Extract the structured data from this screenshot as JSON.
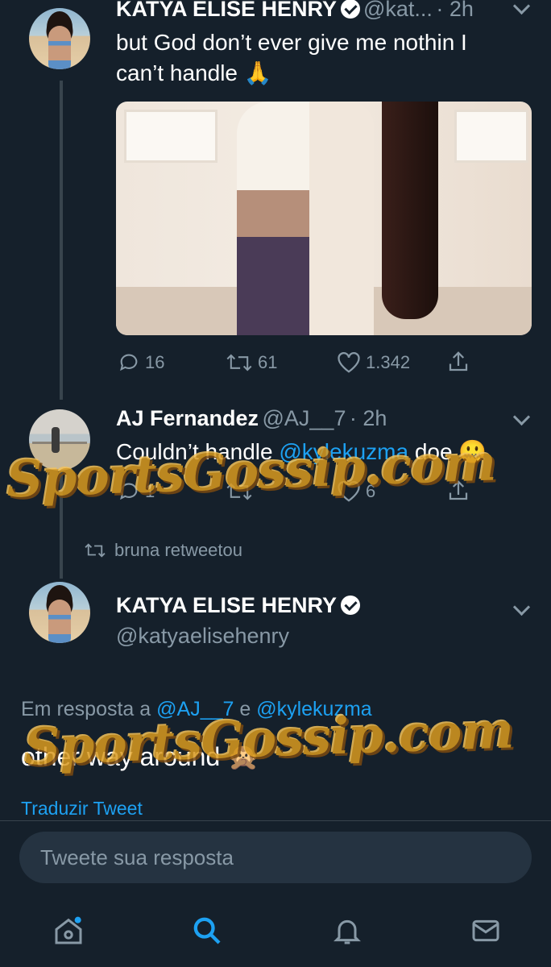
{
  "tweet1": {
    "name": "KATYA ELISE HENRY",
    "handle": "@kat...",
    "time": "· 2h",
    "text_line1": "but God don’t ever give me nothin I",
    "text_line2": "can’t handle 🙏",
    "replies": "16",
    "retweets": "61",
    "likes": "1.342"
  },
  "tweet2": {
    "name": "AJ Fernandez",
    "handle": "@AJ__7",
    "time": "· 2h",
    "text_prefix": "Couldn’t handle ",
    "mention": "@kylekuzma",
    "text_suffix": " doe 🤐",
    "replies": "1",
    "likes": "6"
  },
  "retweet_notice": "bruna retweetou",
  "main_tweet": {
    "name": "KATYA ELISE HENRY",
    "handle": "@katyaelisehenry",
    "reply_to_prefix": "Em resposta a ",
    "reply_to_user1": "@AJ__7",
    "reply_to_and": " e ",
    "reply_to_user2": "@kylekuzma",
    "text": "other way around 🙊",
    "translate": "Traduzir Tweet"
  },
  "reply_placeholder": "Tweete sua resposta",
  "watermark": "SportsGossip.com",
  "colors": {
    "background": "#15202b",
    "accent": "#1da1f2",
    "secondary_text": "#8899a6"
  },
  "icons": {
    "reply": "reply-icon",
    "retweet": "retweet-icon",
    "like": "heart-icon",
    "share": "share-icon",
    "home": "home-icon",
    "search": "search-icon",
    "notifications": "bell-icon",
    "messages": "mail-icon"
  }
}
